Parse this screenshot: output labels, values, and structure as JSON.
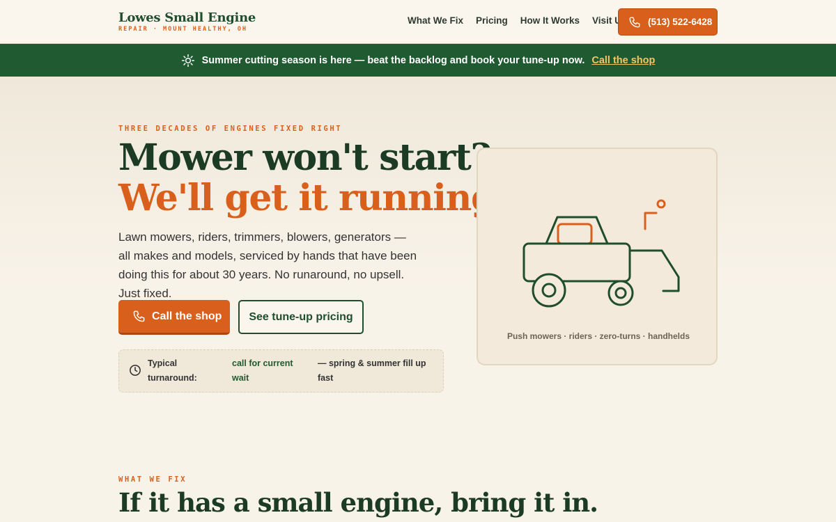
{
  "header": {
    "brand_name": "Lowes Small Engine",
    "brand_sub": "REPAIR · MOUNT HEALTHY, OH",
    "nav": [
      "What We Fix",
      "Pricing",
      "How It Works",
      "Visit Us"
    ],
    "phone_label": "(513) 522-6428"
  },
  "banner": {
    "text": "Summer cutting season is here — beat the backlog and book your tune-up now.",
    "link": "Call the shop"
  },
  "hero": {
    "eyebrow": "THREE DECADES OF ENGINES FIXED RIGHT",
    "headline_line1": "Mower won't start?",
    "headline_line2": "We'll get it running.",
    "lede": "Lawn mowers, riders, trimmers, blowers, generators — all makes and models, serviced by hands that have been doing this for about 30 years. No runaround, no upsell. Just fixed.",
    "primary_button": "Call the shop",
    "secondary_button": "See tune-up pricing",
    "turnaround": {
      "label": "Typical turnaround:",
      "value": "call for current wait",
      "note": "— spring & summer fill up fast"
    },
    "illustration_caption": "Push mowers · riders · zero-turns · handhelds"
  },
  "what_we_fix": {
    "eyebrow": "WHAT WE FIX",
    "title": "If it has a small engine, bring it in."
  },
  "colors": {
    "brand_green": "#1f5a30",
    "accent_orange": "#d9601c",
    "background": "#f8f3e9"
  }
}
